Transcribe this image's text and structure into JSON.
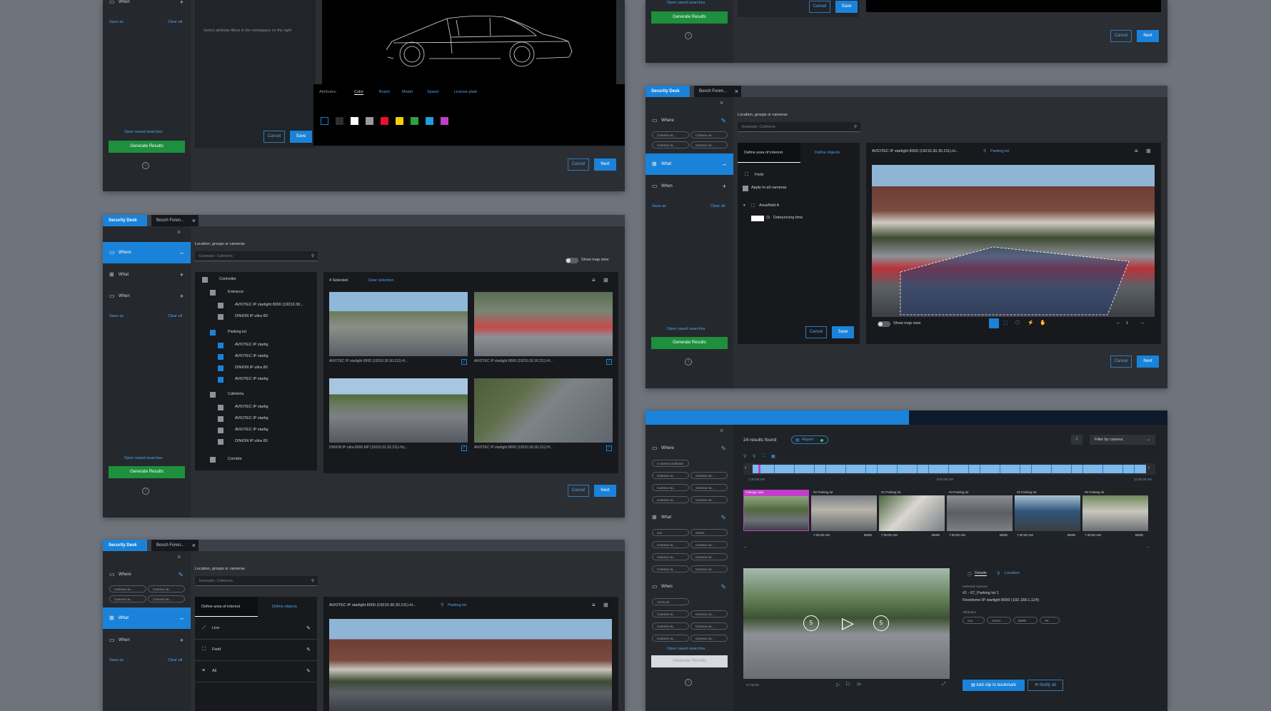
{
  "p1": {
    "when_label": "When",
    "save_as": "Save as",
    "clear_all": "Clear all",
    "hint": "Select attribute filters in the workspace on the right",
    "cancel": "Cancel",
    "save": "Save",
    "attributes_label": "Attributes:",
    "attr_tabs": [
      "Color",
      "Brand",
      "Model",
      "Speed",
      "License plate"
    ],
    "swatches": [
      "#000000",
      "#2e2e2e",
      "#ffffff",
      "#9a9a9a",
      "#e8112d",
      "#f3d000",
      "#2ea043",
      "#1a9fe0",
      "#c13fc8"
    ],
    "open_saved": "Open saved searches",
    "generate": "Generate Results",
    "cancel2": "Cancel",
    "next": "Next"
  },
  "p2": {
    "tab_app": "Security Desk",
    "tab_inv": "Bosch Foren...",
    "where": "Where",
    "what": "What",
    "when": "When",
    "save_as": "Save as",
    "clear_all": "Clear all",
    "location_label": "Location, groups or cameras",
    "search_placeholder": "Example: Cafeteria",
    "show_map": "Show map view",
    "tree": {
      "controller": "Controller",
      "entrance": "Entrance",
      "e1": "AVIOTEC IP starlight 8000 (19210.30...",
      "e2": "DINION IP ultra 80",
      "parking": "Parking lot",
      "p1": "AVIOTEC IP starlig",
      "p2": "AVIOTEC IP starlig",
      "p3": "DINION IP ultra 80",
      "p4": "AVIOTEC IP starlig",
      "cafeteria": "Cafeteria",
      "c1": "AVIOTEC IP starlig",
      "c2": "AVIOTEC IP starlig",
      "c3": "AVIOTEC IP starlig",
      "c4": "DINION IP ultra 80",
      "corridor": "Corridor"
    },
    "selected": "4 Selected",
    "clear_selection": "Clear selection",
    "captions": [
      "AVIOTEC IP starlight 8000 (19210.30.30.211)-H...",
      "AVIOTEC IP starlight 8000 (19210.30.30.211)-H...",
      "DINION IP ultra 8000 MP (19210.32.32.211)-Hy...",
      "AVIOTEC IP starlight 8000 (19210.30.30.211)-H..."
    ],
    "open_saved": "Open saved searches",
    "generate": "Generate Results",
    "cancel": "Cancel",
    "next": "Next"
  },
  "p3": {
    "tab_app": "Security Desk",
    "tab_inv": "Bosch Foren...",
    "where": "Where",
    "what": "What",
    "when": "When",
    "save_as": "Save as",
    "clear_all": "Clear all",
    "chips": [
      "Camera na...",
      "Camera na...",
      "Camera na...",
      "Camera na..."
    ],
    "location_label": "Location, groups or cameras",
    "search_placeholder": "Example: Cafeteria",
    "define_area": "Define area of interest",
    "define_objects": "Define objects",
    "line": "Line",
    "field": "Field",
    "all": "All",
    "camera_title": "AVIOTEC IP starlight 8000 (19210.30.30.211)-H...",
    "location": "Parking lot"
  },
  "p4": {
    "open_saved": "Open saved searches",
    "generate": "Generate Results",
    "cancel": "Cancel",
    "save": "Save",
    "cancel2": "Cancel",
    "next": "Next"
  },
  "p5": {
    "tab_app": "Security Desk",
    "tab_inv": "Bosch Foren...",
    "where": "Where",
    "what": "What",
    "when": "When",
    "save_as": "Save as",
    "clear_all": "Clear all",
    "chips": [
      "Camera na...",
      "Camera na...",
      "Camera na...",
      "Camera na..."
    ],
    "location_label": "Location, groups or cameras",
    "search_placeholder": "Example: Cafeteria",
    "define_area": "Define area of interest",
    "define_objects": "Define objects",
    "field": "Field",
    "apply_all": "Apply to all cameras",
    "area": "Area/field A",
    "debounce": "Debouncing time",
    "camera_title": "AVIOTEC IP starlight 8000 (19210.30.30.211)-H...",
    "location": "Parking lot",
    "show_map": "Show map view",
    "page": "1",
    "open_saved": "Open saved searches",
    "generate": "Generate Results",
    "cancel": "Cancel",
    "save": "Save",
    "cancel2": "Cancel",
    "next": "Next"
  },
  "p6": {
    "where": "Where",
    "where_chips": [
      "4 camera selected",
      "Camera na...",
      "Camera na...",
      "Camera na...",
      "Camera na...",
      "Camera na...",
      "Camera na..."
    ],
    "what": "What",
    "what_chips": [
      "Car",
      "Green",
      "Camera na...",
      "Camera na...",
      "Camera na...",
      "Camera na...",
      "Camera na...",
      "Camera na..."
    ],
    "when": "When",
    "when_chips": [
      "13.01.24",
      "Camera na...",
      "Camera na...",
      "Camera na...",
      "Camera na...",
      "Camera na...",
      "Camera na...",
      "Camera na..."
    ],
    "open_saved": "Open saved searches",
    "generate": "Generate Results",
    "results_found": "24 results found",
    "report": "Report",
    "filter": "Filter by camera",
    "t_start": "7:30:00 AM",
    "t_mid": "8:00:00 AM",
    "t_end": "11:30:00 AM",
    "result_caps": [
      "Canopy cam",
      "#2 Parking lot",
      "#2 Parking lot",
      "#4 Parking lot",
      "#2 Parking lot",
      "#5 Parking lot"
    ],
    "result_sub": "Camera name",
    "result_time": "7:30:00 AM",
    "result_brand": "BMW",
    "details_tab": "Details",
    "location_tab": "Location",
    "selected_camera_label": "Selected Camera",
    "camera_name": "#1 - 67_Parking lot 1",
    "camera_ip": "Flexidome IP starlight 8000 (192.168.1.124)",
    "attributes_label": "Attributes",
    "attr_chips": [
      "Car",
      "Green",
      "BMW",
      "X5"
    ],
    "add_clip": "Add clip to bookmark",
    "notify": "Notify all",
    "skip_back": "5",
    "skip_fwd": "5",
    "time_readout": "07:00:00"
  }
}
